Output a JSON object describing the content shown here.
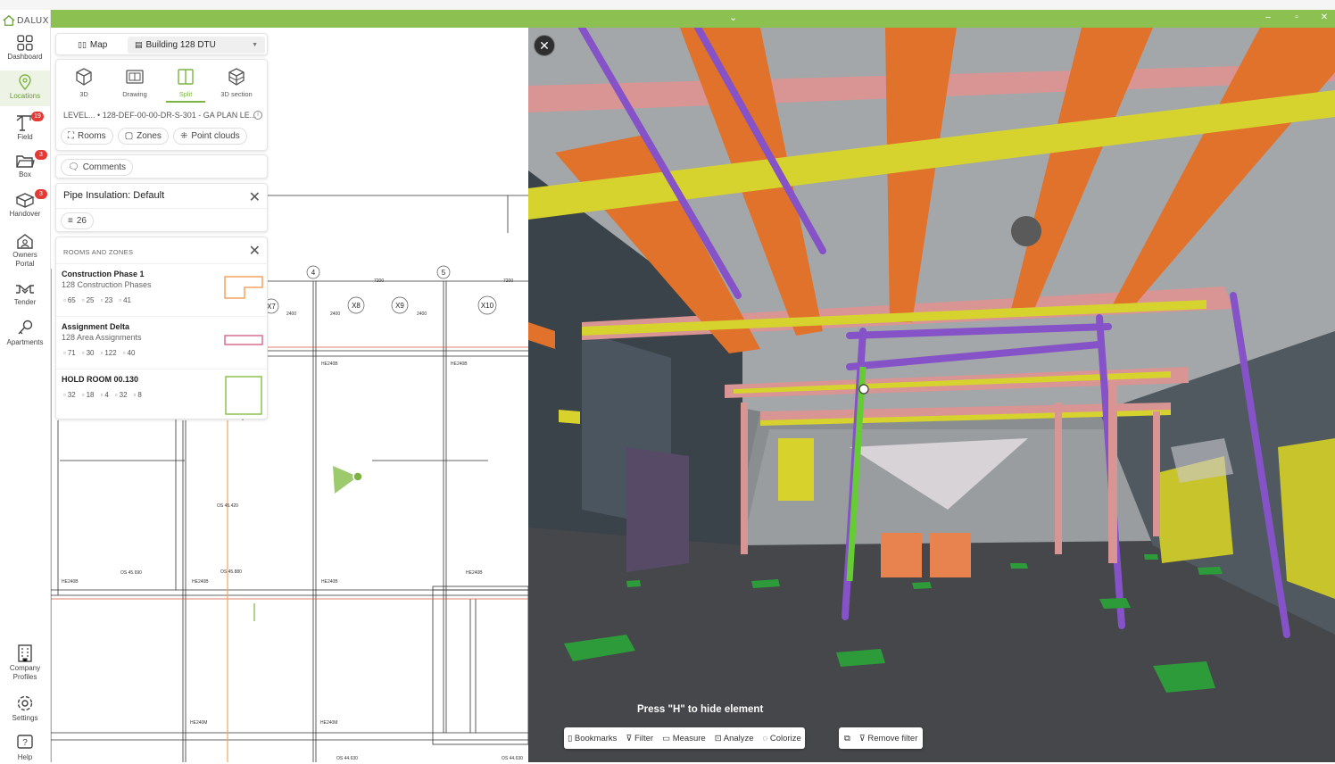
{
  "app": {
    "logo_text": "DALUX"
  },
  "rail": {
    "items": [
      {
        "label": "Dashboard"
      },
      {
        "label": "Locations"
      },
      {
        "label": "Field",
        "badge": "19"
      },
      {
        "label": "Box",
        "badge": "3"
      },
      {
        "label": "Handover",
        "badge": "3"
      },
      {
        "label": "Owners Portal"
      },
      {
        "label": "Tender"
      },
      {
        "label": "Apartments"
      },
      {
        "label": "Company Profiles"
      },
      {
        "label": "Settings"
      },
      {
        "label": "Help"
      }
    ]
  },
  "mapbar": {
    "map_label": "Map",
    "building_label": "Building 128 DTU"
  },
  "viewmodes": {
    "modes": [
      {
        "label": "3D"
      },
      {
        "label": "Drawing"
      },
      {
        "label": "Split"
      },
      {
        "label": "3D section"
      }
    ],
    "active": "Split",
    "level_label": "LEVEL...",
    "drawing_label": "• 128-DEF-00-00-DR-S-301 - GA PLAN LE...",
    "info_icon": "ⓘ",
    "chips": {
      "rooms": "Rooms",
      "zones": "Zones",
      "point_clouds": "Point clouds"
    }
  },
  "comments": {
    "label": "Comments"
  },
  "filter_panel": {
    "title": "Pipe Insulation: Default",
    "count": "26"
  },
  "rooms_panel": {
    "header": "ROOMS AND ZONES",
    "rooms": [
      {
        "name": "Construction Phase 1",
        "sub": "128 Construction Phases",
        "stats": [
          "65",
          "25",
          "23",
          "41"
        ],
        "color": "#f4a360"
      },
      {
        "name": "Assignment Delta",
        "sub": "128 Area Assignments",
        "stats": [
          "71",
          "30",
          "122",
          "40"
        ],
        "color": "#d86f8f"
      },
      {
        "name": "HOLD ROOM 00.130",
        "sub": "",
        "stats": [
          "32",
          "18",
          "4",
          "32",
          "8"
        ],
        "color": "#8cc152"
      }
    ]
  },
  "drawing": {
    "grid_labels": [
      "4",
      "5",
      "X7",
      "X8",
      "X9",
      "X10"
    ],
    "annotations": [
      "HE240B",
      "HE240M",
      "OS 45.420",
      "OS 45.690",
      "OS 45.880",
      "OS 44.630",
      "BS0X1",
      "2400",
      "7200"
    ]
  },
  "view3d": {
    "hint": "Press \"H\" to hide element",
    "toolbar": [
      "Bookmarks",
      "Filter",
      "Measure",
      "Analyze",
      "Colorize"
    ],
    "remove_filter": "Remove filter"
  },
  "colors": {
    "accent": "#8cc152",
    "badge": "#e53935"
  }
}
